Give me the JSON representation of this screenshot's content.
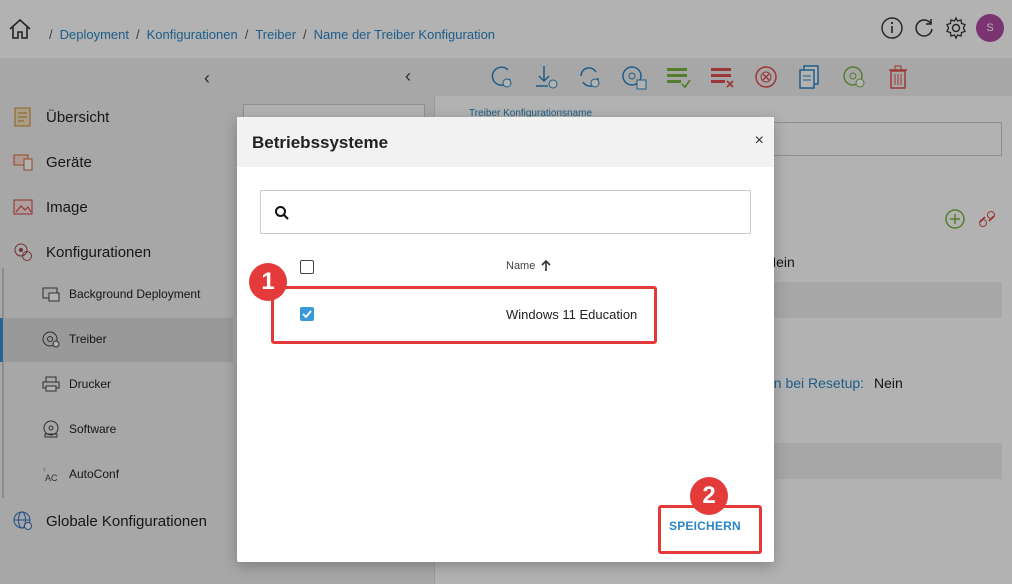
{
  "breadcrumb": {
    "separator": "/",
    "items": [
      "Deployment",
      "Konfigurationen",
      "Treiber",
      "Name der Treiber Konfiguration"
    ]
  },
  "topbar": {
    "avatar_initial": "S",
    "icons": [
      "home-icon",
      "info-icon",
      "refresh-icon",
      "settings-icon"
    ]
  },
  "sidebar": {
    "items": [
      {
        "label": "Übersicht",
        "icon": "overview-icon"
      },
      {
        "label": "Geräte",
        "icon": "devices-icon"
      },
      {
        "label": "Image",
        "icon": "image-icon"
      },
      {
        "label": "Konfigurationen",
        "icon": "configurations-icon"
      }
    ],
    "subitems": [
      {
        "label": "Background Deployment",
        "icon": "background-deployment-icon"
      },
      {
        "label": "Treiber",
        "icon": "driver-icon",
        "active": true
      },
      {
        "label": "Drucker",
        "icon": "printer-icon"
      },
      {
        "label": "Software",
        "icon": "software-icon"
      },
      {
        "label": "AutoConf",
        "icon": "autoconf-icon"
      }
    ],
    "global": {
      "label": "Globale Konfigurationen",
      "icon": "globe-settings-icon"
    }
  },
  "background": {
    "field_label": "Treiber Konfigurationsname",
    "text_nein_1": "Nein",
    "text_resetup_label": "en bei Resetup:",
    "text_resetup_value": "Nein",
    "text_nein_2": "n"
  },
  "modal": {
    "title": "Betriebssysteme",
    "close": "×",
    "search_placeholder": "",
    "column_name": "Name",
    "rows": [
      {
        "name": "Windows 11 Education",
        "checked": true
      }
    ],
    "save_label": "SPEICHERN"
  },
  "callouts": {
    "badge_1": "1",
    "badge_2": "2"
  },
  "colors": {
    "accent": "#2b86c5",
    "callout": "#e53a3a",
    "checkbox": "#3a9ad9",
    "avatar": "#b04aa4"
  }
}
